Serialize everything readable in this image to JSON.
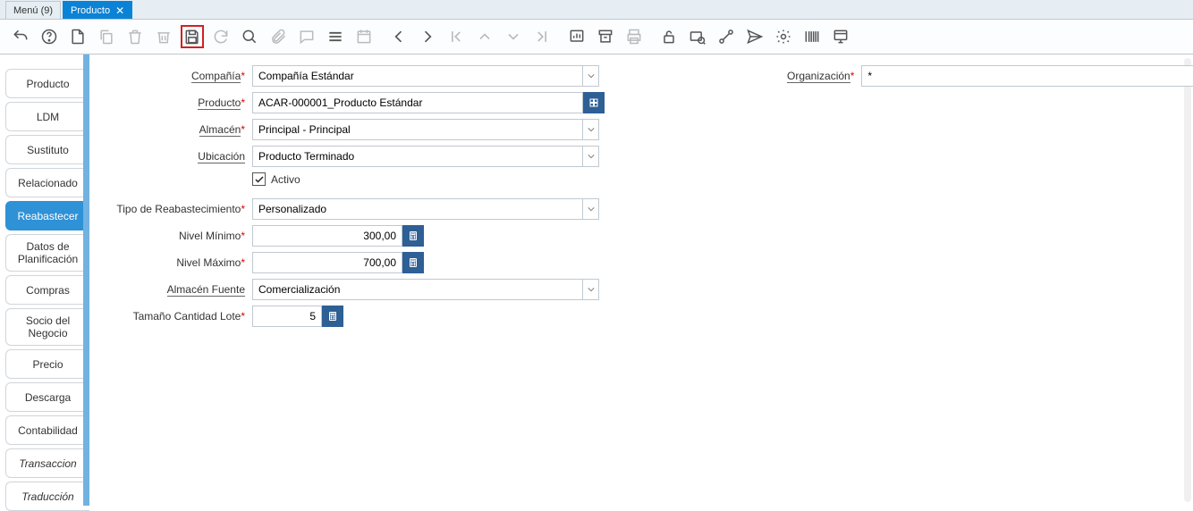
{
  "tabs": {
    "menu": "Menú (9)",
    "producto": "Producto"
  },
  "side": {
    "producto": "Producto",
    "ldm": "LDM",
    "sustituto": "Sustituto",
    "relacionado": "Relacionado",
    "reabastecer": "Reabastecer",
    "datos_plan_l1": "Datos de",
    "datos_plan_l2": "Planificación",
    "compras": "Compras",
    "socio_l1": "Socio del",
    "socio_l2": "Negocio",
    "precio": "Precio",
    "descarga": "Descarga",
    "contabilidad": "Contabilidad",
    "transaccion": "Transaccion",
    "traduccion": "Traducción"
  },
  "labels": {
    "compania": "Compañía",
    "organizacion": "Organización",
    "producto": "Producto",
    "almacen": "Almacén",
    "ubicacion": "Ubicación",
    "activo": "Activo",
    "tipo_reab": "Tipo de Reabastecimiento",
    "nivel_min": "Nivel Mínimo",
    "nivel_max": "Nivel Máximo",
    "almacen_fuente": "Almacén Fuente",
    "tam_lote": "Tamaño Cantidad Lote"
  },
  "values": {
    "compania": "Compañía Estándar",
    "organizacion": "*",
    "producto": "ACAR-000001_Producto Estándar",
    "almacen": "Principal - Principal",
    "ubicacion": "Producto Terminado",
    "tipo_reab": "Personalizado",
    "nivel_min": "300,00",
    "nivel_max": "700,00",
    "almacen_fuente": "Comercialización",
    "tam_lote": "5"
  }
}
